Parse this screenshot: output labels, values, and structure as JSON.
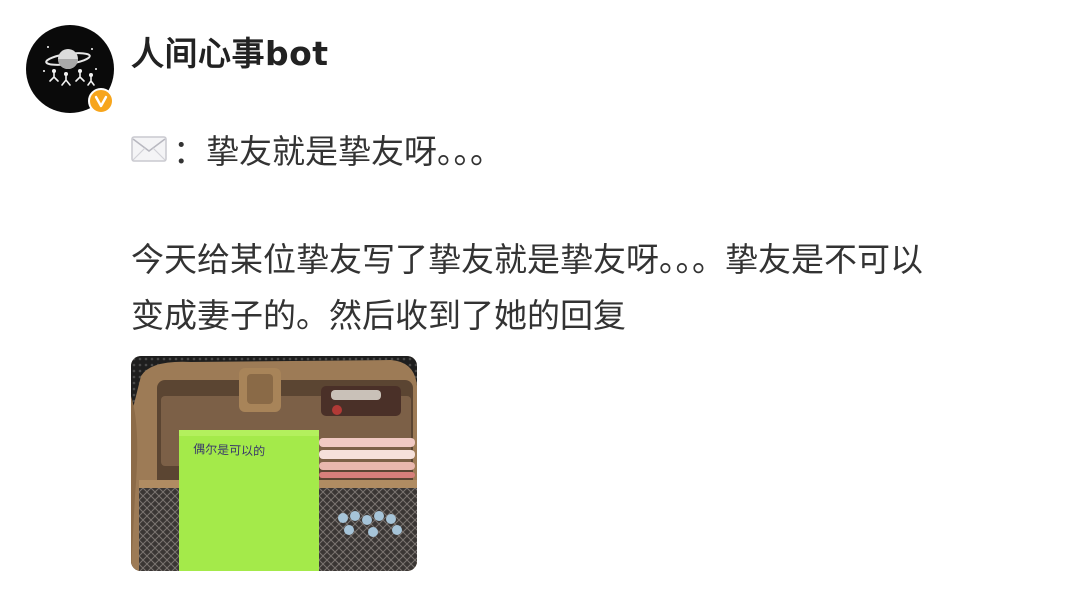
{
  "post": {
    "username": "人间心事bot",
    "mail_icon": "envelope-icon",
    "colon": "：",
    "title_text": "挚友就是挚友呀。。。",
    "body_line1": "今天给某位挚友写了挚友就是挚友呀。。。挚友是不可以",
    "body_line2": "变成妻子的。然后收到了她的回复",
    "verified_icon": "verified-badge-icon"
  },
  "photo": {
    "note_text": "偶尔是可以的",
    "note_color": "#a4ea4a"
  },
  "colors": {
    "avatar_bg": "#0a0a0a",
    "badge": "#f7a51c",
    "text": "#333333"
  }
}
